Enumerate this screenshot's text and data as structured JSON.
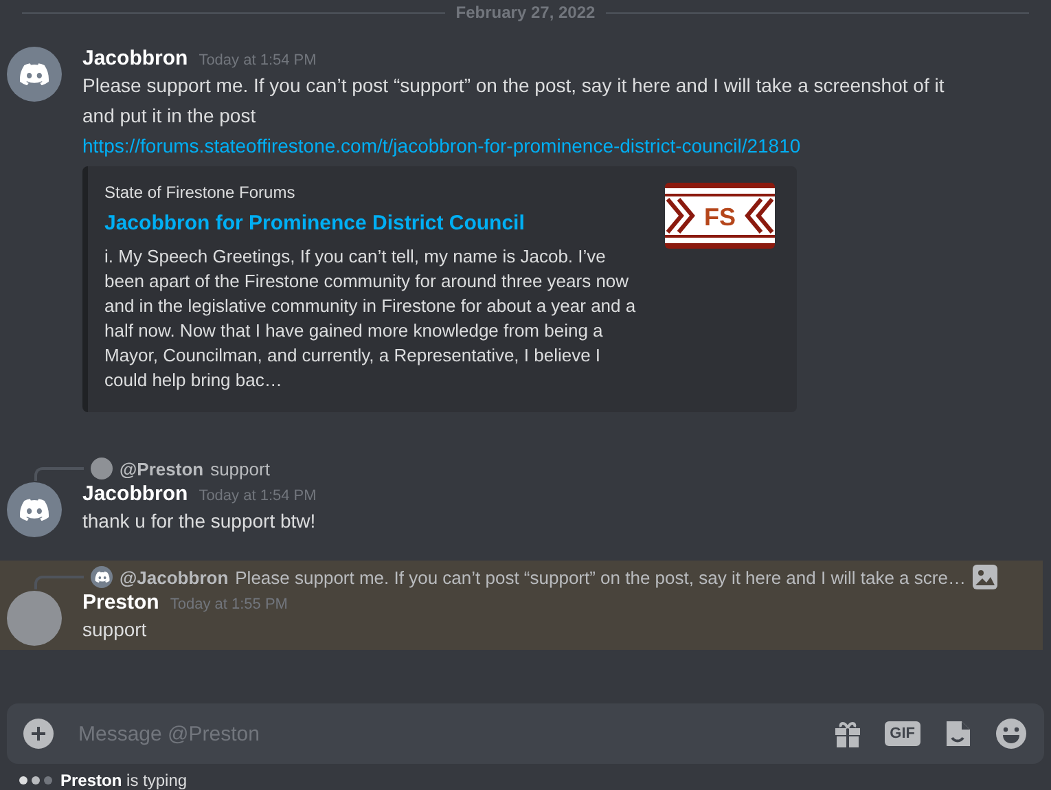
{
  "date_divider": "February 27, 2022",
  "messages": [
    {
      "author": "Jacobbron",
      "avatar": {
        "kind": "logo"
      },
      "time": "Today at 1:54 PM",
      "highlighted": false,
      "text": "Please support me. If you can’t post “support” on the post, say it here and I will take a screenshot of it and put it in the post",
      "link": "https://forums.stateoffirestone.com/t/jacobbron-for-prominence-district-council/21810",
      "embed": {
        "site": "State of Firestone Forums",
        "title": "Jacobbron for Prominence District Council",
        "description": "i. My Speech Greetings, If you can’t tell, my name is Jacob. I’ve been apart of the Firestone community for around three years now and in the legislative community in Firestone for about a year and a half now. Now that I have gained more knowledge from being a Mayor, Councilman, and currently, a Representative, I believe I could help bring bac…",
        "thumbnail_text": "FS"
      }
    },
    {
      "author": "Jacobbron",
      "avatar": {
        "kind": "logo"
      },
      "time": "Today at 1:54 PM",
      "highlighted": false,
      "text": "thank u for the support btw!",
      "reply": {
        "avatar": {
          "kind": "photo"
        },
        "mention": "@Preston",
        "text": "support",
        "has_image": false
      }
    },
    {
      "author": "Preston",
      "avatar": {
        "kind": "photo"
      },
      "time": "Today at 1:55 PM",
      "highlighted": true,
      "text": "support",
      "reply": {
        "avatar": {
          "kind": "logo"
        },
        "mention": "@Jacobbron",
        "text": "Please support me. If you can’t post “support” on the post, say it here and I will take a scre…",
        "has_image": true
      }
    }
  ],
  "composer": {
    "placeholder": "Message @Preston",
    "gif_label": "GIF"
  },
  "typing": "**Preston** is typing"
}
